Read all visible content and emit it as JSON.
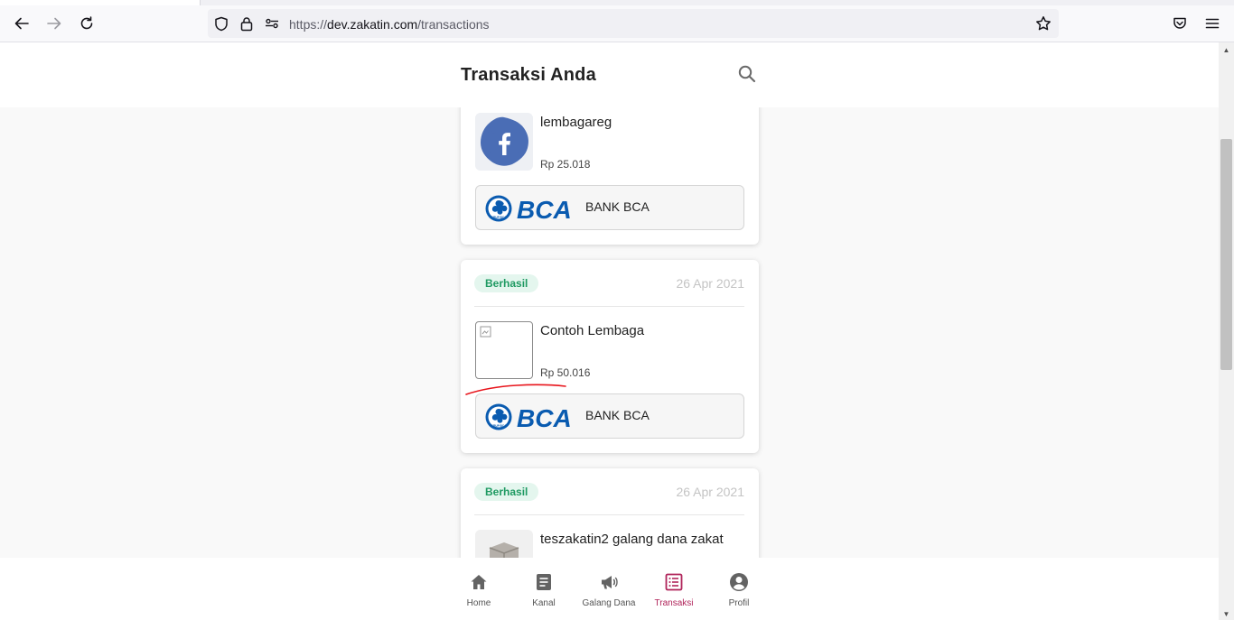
{
  "browser": {
    "url_scheme": "https://",
    "url_host": "dev.zakatin.com",
    "url_path": "/transactions",
    "icons": [
      "back-arrow-icon",
      "forward-arrow-icon",
      "reload-icon",
      "shield-icon",
      "lock-icon",
      "site-permissions-icon",
      "bookmark-star-icon",
      "pocket-icon",
      "menu-icon"
    ]
  },
  "header": {
    "title": "Transaksi Anda",
    "search_icon": "search-icon"
  },
  "transactions": [
    {
      "status": "",
      "date": "",
      "org_name": "lembagareg",
      "amount": "Rp 25.018",
      "thumb": "facebook-logo",
      "bank_label": "BCA",
      "bank_name": "BANK BCA"
    },
    {
      "status": "Berhasil",
      "date": "26 Apr 2021",
      "org_name": "Contoh Lembaga",
      "amount": "Rp 50.016",
      "thumb": "broken-image",
      "bank_label": "BCA",
      "bank_name": "BANK BCA"
    },
    {
      "status": "Berhasil",
      "date": "26 Apr 2021",
      "org_name": "teszakatin2 galang dana zakat",
      "amount": "",
      "thumb": "box-image",
      "bank_label": "",
      "bank_name": ""
    }
  ],
  "bottom_nav": [
    {
      "label": "Home",
      "icon": "home-icon",
      "active": false
    },
    {
      "label": "Kanal",
      "icon": "document-icon",
      "active": false
    },
    {
      "label": "Galang Dana",
      "icon": "megaphone-icon",
      "active": false
    },
    {
      "label": "Transaksi",
      "icon": "list-icon",
      "active": true
    },
    {
      "label": "Profil",
      "icon": "user-circle-icon",
      "active": false
    }
  ],
  "colors": {
    "status_bg": "#e4f6ee",
    "status_text": "#1f9a62",
    "active_nav": "#b0245a",
    "bca_blue": "#0a5bb0",
    "annotation_red": "#e8141b"
  }
}
